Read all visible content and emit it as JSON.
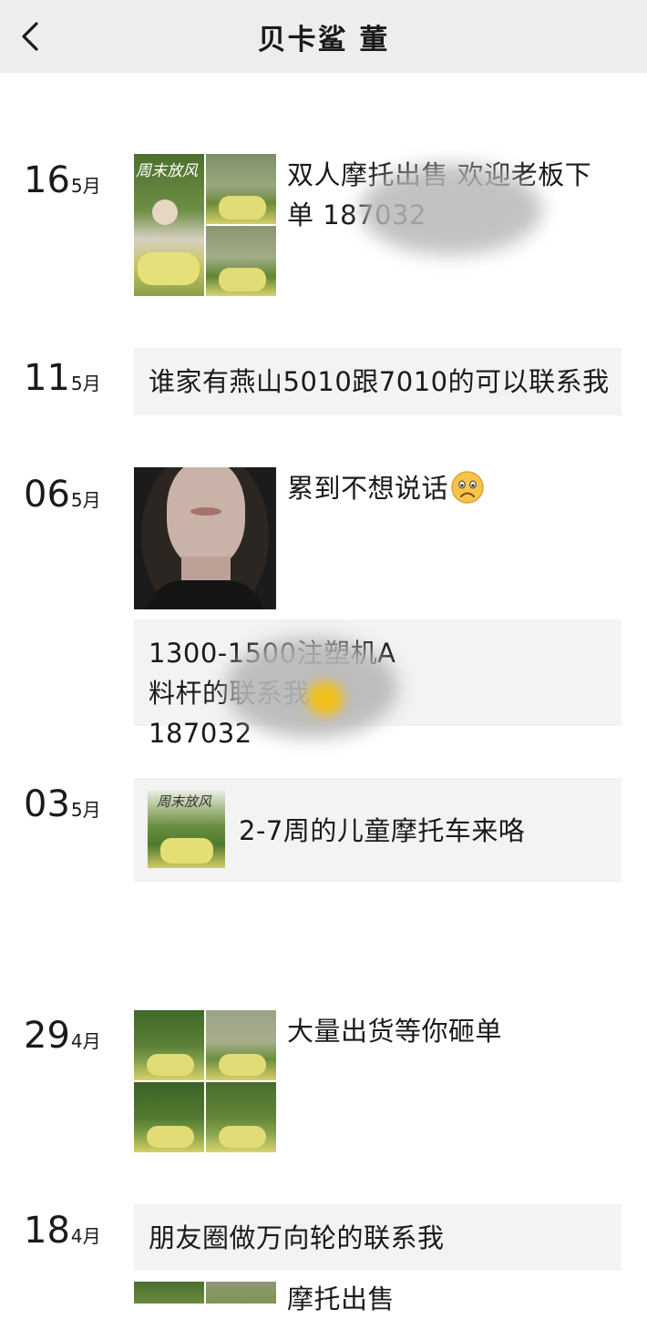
{
  "header": {
    "title": "贝卡鲨 董",
    "back_icon": "chevron-left-icon"
  },
  "posts": [
    {
      "day": "16",
      "month": "5月",
      "text": "双人摩托出售 欢迎老板下单 187032",
      "images": 3,
      "image_caption": "周末放风"
    },
    {
      "day": "11",
      "month": "5月",
      "text": "谁家有燕山5010跟7010的可以联系我"
    },
    {
      "day": "06",
      "month": "5月",
      "text": "累到不想说话",
      "emoji": "frowning-face-emoji",
      "images": 1
    },
    {
      "text": "1300-1500注塑机A料杆的联系我 187032"
    },
    {
      "day": "03",
      "month": "5月",
      "text": "2-7周的儿童摩托车来咯",
      "image_caption": "周末放风"
    },
    {
      "day": "29",
      "month": "4月",
      "text": "大量出货等你砸单",
      "images": 4
    },
    {
      "day": "18",
      "month": "4月",
      "text": "朋友圈做万向轮的联系我"
    },
    {
      "text": "摩托出售",
      "images": 3
    }
  ]
}
